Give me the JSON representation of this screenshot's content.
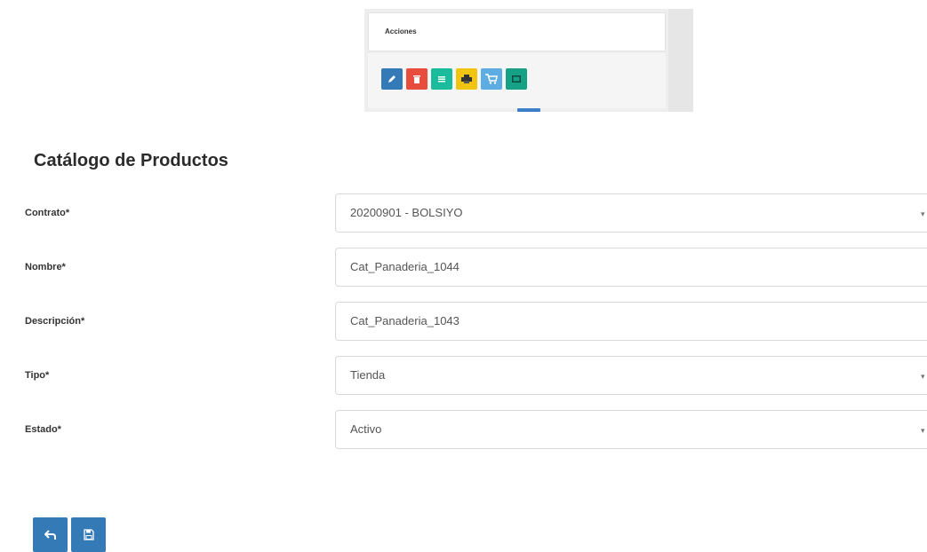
{
  "acciones": {
    "header": "Acciones",
    "buttons": [
      {
        "name": "edit",
        "color": "#337ab7"
      },
      {
        "name": "delete",
        "color": "#e74c3c"
      },
      {
        "name": "list",
        "color": "#1abc9c"
      },
      {
        "name": "print",
        "color": "#f1c40f"
      },
      {
        "name": "cart",
        "color": "#5dade2"
      },
      {
        "name": "view",
        "color": "#16a085"
      }
    ]
  },
  "form": {
    "title": "Catálogo de Productos",
    "fields": {
      "contrato": {
        "label": "Contrato*",
        "value": "20200901 - BOLSIYO",
        "caret": "▾"
      },
      "nombre": {
        "label": "Nombre*",
        "value": "Cat_Panaderia_1044"
      },
      "descripcion": {
        "label": "Descripción*",
        "value": "Cat_Panaderia_1043"
      },
      "tipo": {
        "label": "Tipo*",
        "value": "Tienda",
        "caret": "▾"
      },
      "estado": {
        "label": "Estado*",
        "value": "Activo",
        "caret": "▾"
      }
    }
  },
  "colors": {
    "primary": "#337ab7"
  }
}
